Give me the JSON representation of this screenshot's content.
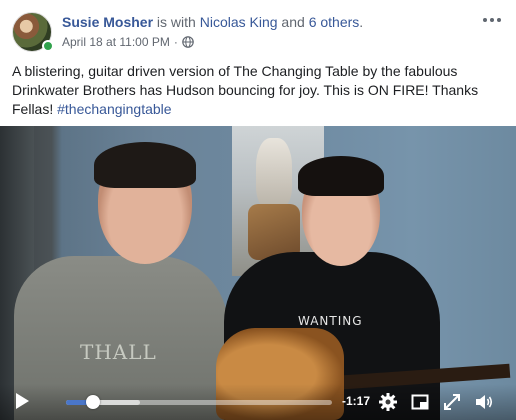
{
  "post": {
    "author": "Susie Mosher",
    "with_text": " is with ",
    "tagged_person": "Nicolas King",
    "and_text": " and ",
    "others": "6 others",
    "period": ".",
    "timestamp": "April 18 at 11:00 PM",
    "dot": "·",
    "privacy_icon": "globe-icon",
    "more_icon": "more-options-icon",
    "text": "A blistering, guitar driven version of The Changing Table by the fabulous Drinkwater Brothers has Hudson bouncing for joy. This is ON FIRE! Thanks Fellas! ",
    "hashtag": "#thechangingtable"
  },
  "video": {
    "shirt_text_left": "THALL",
    "shirt_text_right": "WANTING",
    "progress": 0.1,
    "buffered": 0.28,
    "time_remaining": "-1:17",
    "icons": [
      "play-icon",
      "settings-gear-icon",
      "fullscreen-icon",
      "expand-icon",
      "volume-icon"
    ]
  },
  "colors": {
    "link": "#385898",
    "progress": "#4a76c9",
    "online": "#31a24c"
  }
}
